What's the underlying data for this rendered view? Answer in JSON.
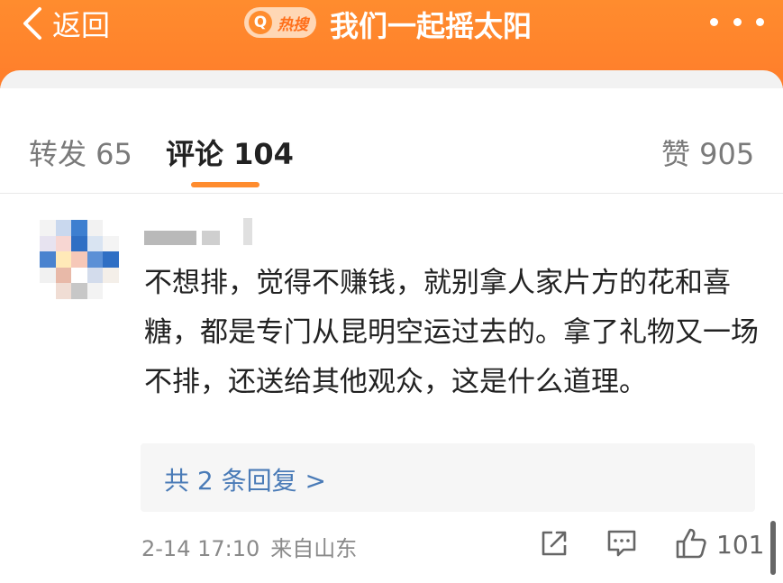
{
  "header": {
    "back_label": "返回",
    "badge_q": "Q",
    "badge_text": "热搜",
    "title": "我们一起摇太阳",
    "accent_color": "#ff8c2e"
  },
  "tabs": [
    {
      "label": "转发 65",
      "active": false
    },
    {
      "label": "评论 104",
      "active": true
    },
    {
      "label": "赞 905",
      "active": false
    }
  ],
  "comment": {
    "text": "不想排，觉得不赚钱，就别拿人家片方的花和喜糖，都是专门从昆明空运过去的。拿了礼物又一场不排，还送给其他观众，这是什么道理。",
    "replies_label": "共 2 条回复 >",
    "date": "2-14 17:10",
    "location": "来自山东",
    "like_count": "101",
    "icons": [
      "share-icon",
      "comment-icon",
      "like-icon"
    ]
  }
}
